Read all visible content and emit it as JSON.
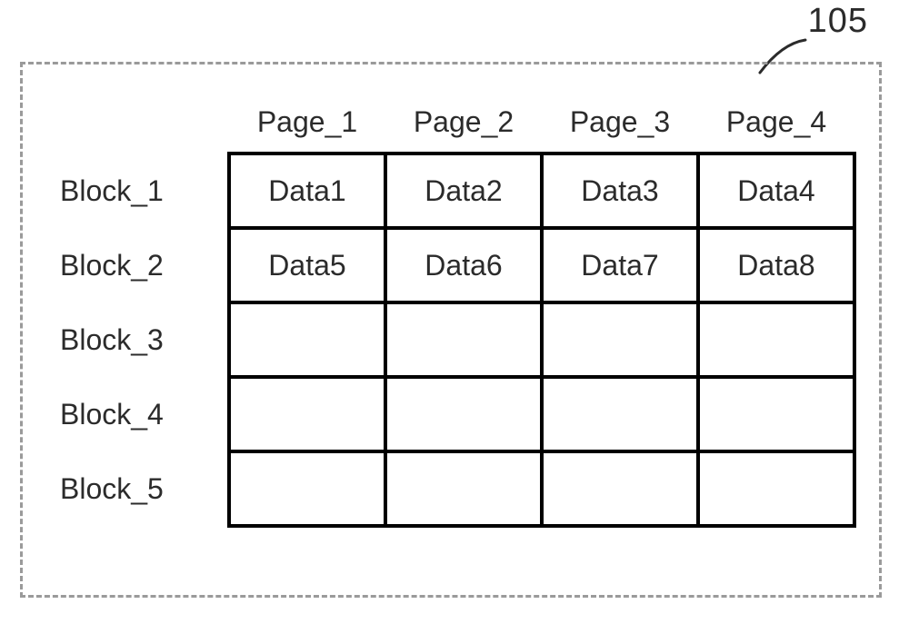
{
  "figure": {
    "ref": "105"
  },
  "columns": [
    "Page_1",
    "Page_2",
    "Page_3",
    "Page_4"
  ],
  "rows": [
    {
      "label": "Block_1",
      "cells": [
        "Data1",
        "Data2",
        "Data3",
        "Data4"
      ]
    },
    {
      "label": "Block_2",
      "cells": [
        "Data5",
        "Data6",
        "Data7",
        "Data8"
      ]
    },
    {
      "label": "Block_3",
      "cells": [
        "",
        "",
        "",
        ""
      ]
    },
    {
      "label": "Block_4",
      "cells": [
        "",
        "",
        "",
        ""
      ]
    },
    {
      "label": "Block_5",
      "cells": [
        "",
        "",
        "",
        ""
      ]
    }
  ]
}
